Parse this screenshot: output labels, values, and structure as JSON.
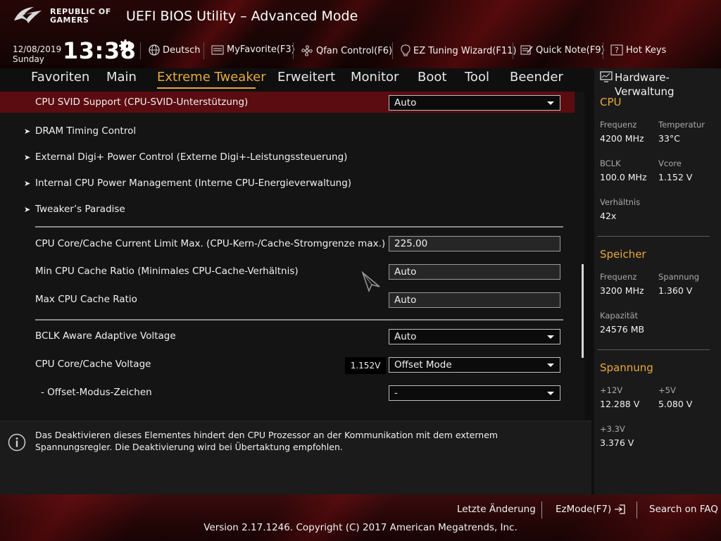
{
  "header": {
    "brand_line1": "REPUBLIC OF",
    "brand_line2": "GAMERS",
    "title": "UEFI BIOS Utility – Advanced Mode",
    "date": "12/08/2019",
    "day": "Sunday",
    "time": "13:38",
    "toolbar": [
      {
        "icon": "globe-icon",
        "label": "Deutsch"
      },
      {
        "icon": "myfavorite-icon",
        "label": "MyFavorite(F3)"
      },
      {
        "icon": "fan-icon",
        "label": "Qfan Control(F6)"
      },
      {
        "icon": "lightbulb-icon",
        "label": "EZ Tuning Wizard(F11)"
      },
      {
        "icon": "quicknote-icon",
        "label": "Quick Note(F9)"
      },
      {
        "icon": "help-icon",
        "label": "Hot Keys"
      }
    ]
  },
  "nav": {
    "tabs": [
      "Favoriten",
      "Main",
      "Extreme Tweaker",
      "Erweitert",
      "Monitor",
      "Boot",
      "Tool",
      "Beender"
    ],
    "active_tab": "Extreme Tweaker"
  },
  "settings": {
    "svid": {
      "label": "CPU SVID Support (CPU-SVID-Unterstützung)",
      "value": "Auto"
    },
    "submenus": [
      "DRAM Timing Control",
      "External Digi+ Power Control (Externe Digi+-Leistungssteuerung)",
      "Internal CPU Power Management (Interne CPU-Energieverwaltung)",
      "Tweaker’s Paradise"
    ],
    "current_limit": {
      "label": "CPU Core/Cache Current Limit Max. (CPU-Kern-/Cache-Stromgrenze max.)",
      "value": "225.00"
    },
    "min_cache_ratio": {
      "label": "Min CPU Cache Ratio (Minimales CPU-Cache-Verhältnis)",
      "value": "Auto"
    },
    "max_cache_ratio": {
      "label": "Max CPU Cache Ratio",
      "value": "Auto"
    },
    "bclk_adaptive": {
      "label": "BCLK Aware Adaptive Voltage",
      "value": "Auto"
    },
    "core_voltage": {
      "label": "CPU Core/Cache Voltage",
      "reading": "1.152V",
      "value": "Offset Mode"
    },
    "offset_sign": {
      "label": "- Offset-Modus-Zeichen",
      "value": "-"
    }
  },
  "info": {
    "text": "Das Deaktivieren dieses Elementes hindert den CPU Prozessor an der Kommunikation mit dem externem Spannungsregler. Die Deaktivierung wird bei Übertaktung empfohlen."
  },
  "hardware_monitor": {
    "title": "Hardware-Verwaltung",
    "cpu": {
      "heading": "CPU",
      "freq_label": "Frequenz",
      "freq": "4200 MHz",
      "temp_label": "Temperatur",
      "temp": "33°C",
      "bclk_label": "BCLK",
      "bclk": "100.0 MHz",
      "vcore_label": "Vcore",
      "vcore": "1.152 V",
      "ratio_label": "Verhältnis",
      "ratio": "42x"
    },
    "memory": {
      "heading": "Speicher",
      "freq_label": "Frequenz",
      "freq": "3200 MHz",
      "volt_label": "Spannung",
      "volt": "1.360 V",
      "cap_label": "Kapazität",
      "cap": "24576 MB"
    },
    "voltage": {
      "heading": "Spannung",
      "v12_label": "+12V",
      "v12": "12.288 V",
      "v5_label": "+5V",
      "v5": "5.080 V",
      "v33_label": "+3.3V",
      "v33": "3.376 V"
    }
  },
  "footer": {
    "last_change": "Letzte Änderung",
    "ezmode": "EzMode(F7)",
    "faq": "Search on FAQ",
    "copyright": "Version 2.17.1246. Copyright (C) 2017 American Megatrends, Inc."
  },
  "colors": {
    "accent": "#e8a93a",
    "highlight_row": "#5b0c10",
    "brand_red": "#b01418"
  }
}
